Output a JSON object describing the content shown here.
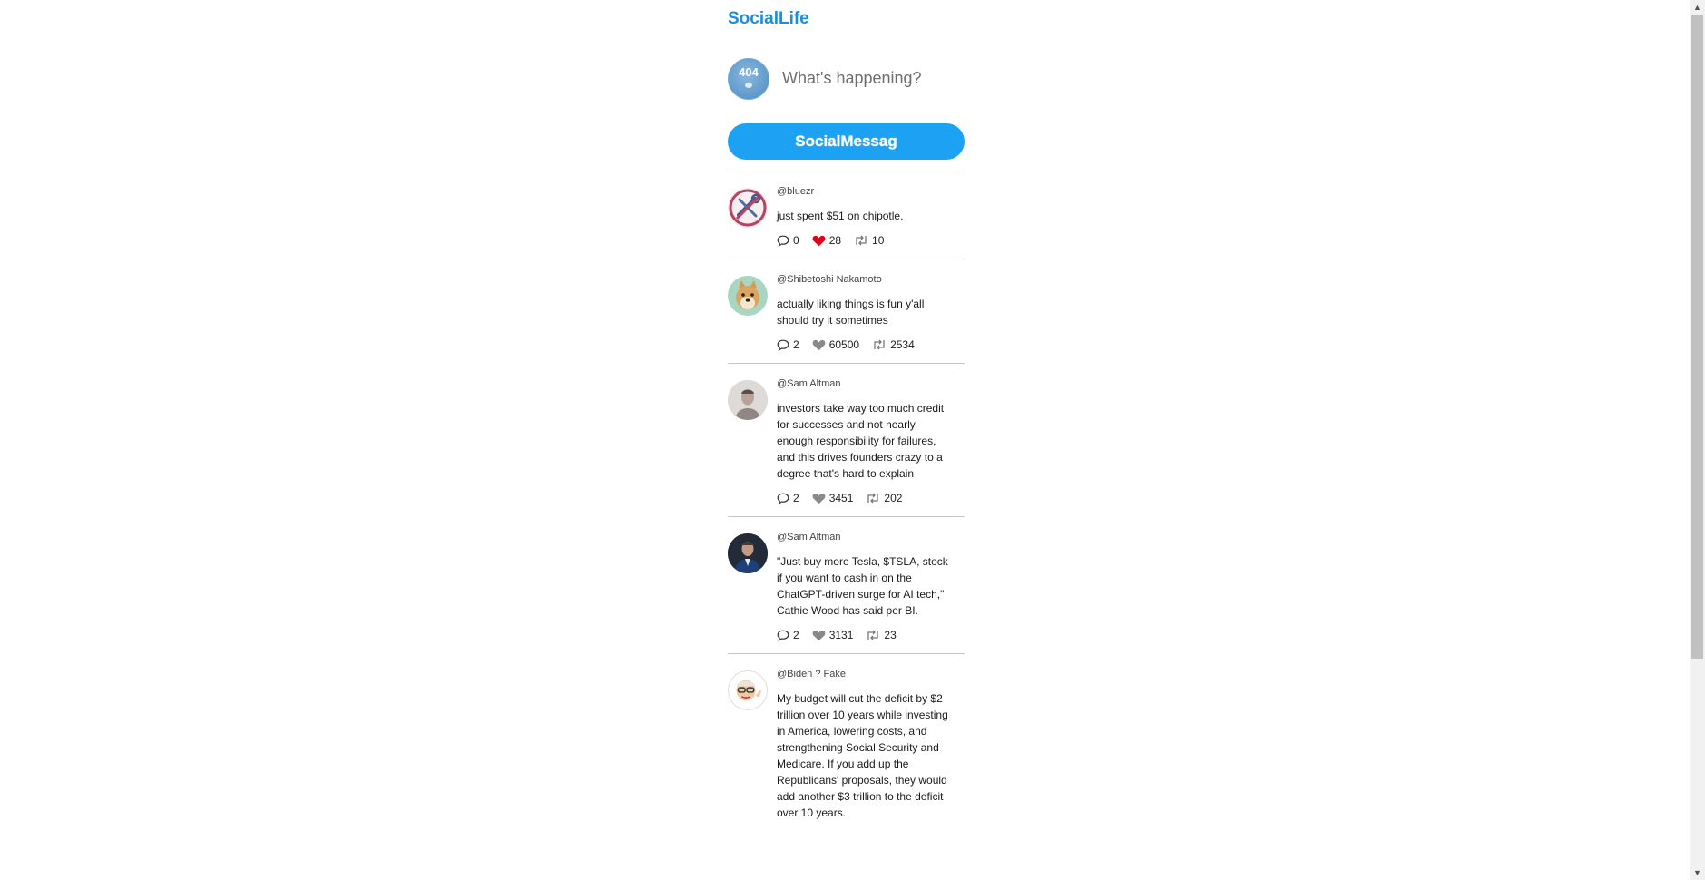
{
  "app": {
    "title": "SocialLife"
  },
  "compose": {
    "avatar_text": "404",
    "placeholder": "What's happening?",
    "submit_label": "SocialMessag"
  },
  "colors": {
    "brand": "#1d8fd8",
    "button": "#1da1f2",
    "liked": "#e0001a",
    "icon": "#8a8a8a"
  },
  "posts": [
    {
      "handle": "@bluezr",
      "content": "just spent $51 on chipotle.",
      "comments": "0",
      "likes": "28",
      "reposts": "10",
      "liked": true,
      "avatar_icon": "no-tools-icon"
    },
    {
      "handle": "@Shibetoshi Nakamoto",
      "content": "actually liking things is fun y'all should try it sometimes",
      "comments": "2",
      "likes": "60500",
      "reposts": "2534",
      "liked": false,
      "avatar_icon": "shiba-dog-avatar"
    },
    {
      "handle": "@Sam Altman",
      "content": "investors take way too much credit for successes and not nearly enough responsibility for failures, and this drives founders crazy to a degree that's hard to explain",
      "comments": "2",
      "likes": "3451",
      "reposts": "202",
      "liked": false,
      "avatar_icon": "portrait-avatar"
    },
    {
      "handle": "@Sam Altman",
      "content": "\"Just buy more Tesla, $TSLA, stock if you want to cash in on the ChatGPT-driven surge for AI tech,\" Cathie Wood has said per BI.",
      "comments": "2",
      "likes": "3131",
      "reposts": "23",
      "liked": false,
      "avatar_icon": "portrait-avatar-dark"
    },
    {
      "handle": "@Biden ? Fake",
      "content": "My budget will cut the deficit by $2 trillion over 10 years while investing in America, lowering costs, and strengthening Social Security and Medicare. If you add up the Republicans' proposals, they would add another $3 trillion to the deficit over 10 years.",
      "comments": "",
      "likes": "",
      "reposts": "",
      "liked": false,
      "avatar_icon": "cartoon-man-avatar"
    }
  ]
}
